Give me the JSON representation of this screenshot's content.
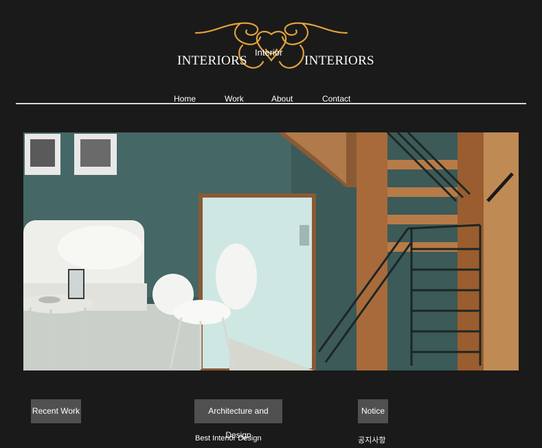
{
  "logo": {
    "left_word": "INTERIORS",
    "center_word": "Interior",
    "right_word": "INTERIORS"
  },
  "nav": {
    "items": [
      "Home",
      "Work",
      "About",
      "Contact"
    ]
  },
  "hero": {
    "image_description": ""
  },
  "sections": {
    "recent_work": {
      "label": "Recent Work"
    },
    "architecture": {
      "label": "Architecture and Design",
      "subtitle": "Best Interior Design"
    },
    "notice": {
      "label": "Notice",
      "subtitle": "공지사항"
    }
  },
  "colors": {
    "background": "#1a1a1a",
    "accent_gold": "#e0a33a",
    "box": "#505050"
  }
}
